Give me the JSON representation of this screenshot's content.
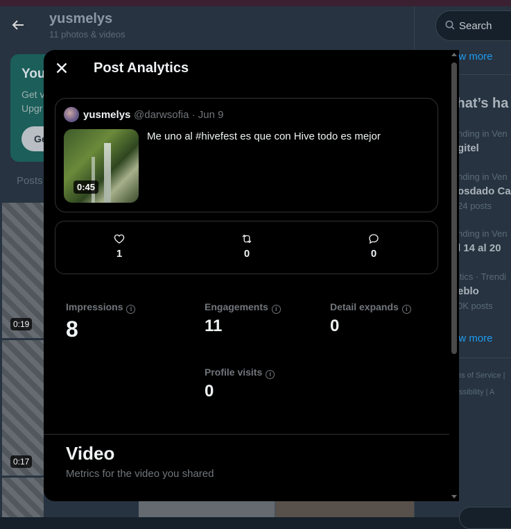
{
  "profile": {
    "name": "yusmelys",
    "subtitle": "11 photos & videos",
    "upgrade_title": "You",
    "upgrade_line1": "Get v",
    "upgrade_line2": "Upgr",
    "upgrade_button": "Ge",
    "posts_tab": "Posts",
    "media": [
      {
        "duration": "0:19"
      },
      {
        "duration": "0:17"
      }
    ]
  },
  "sidebar": {
    "search_placeholder": "Search",
    "show_more_top": "ow more",
    "whats_happening": "/hat’s ha",
    "trends": [
      {
        "meta": "nding in Ven",
        "name": "gitel",
        "count": ""
      },
      {
        "meta": "nding in Ven",
        "name": "osdado Ca",
        "count": "24 posts"
      },
      {
        "meta": "nding in Ven",
        "name": "l 14 al 20",
        "count": ""
      },
      {
        "meta": "itics · Trendi",
        "name": "eblo",
        "count": "0K posts"
      }
    ],
    "show_more_bottom": "ow more",
    "footer_1": "ms of Service  |",
    "footer_2": "essibility   |   A"
  },
  "modal": {
    "title": "Post Analytics",
    "post": {
      "author_name": "yusmelys",
      "author_meta": "@darwsofia · Jun 9",
      "text": "Me uno al #hivefest es que con Hive todo es mejor",
      "video_duration": "0:45"
    },
    "engagement": {
      "likes": "1",
      "reposts": "0",
      "replies": "0"
    },
    "metrics": {
      "impressions_label": "Impressions",
      "impressions_value": "8",
      "engagements_label": "Engagements",
      "engagements_value": "11",
      "detail_expands_label": "Detail expands",
      "detail_expands_value": "0",
      "profile_visits_label": "Profile visits",
      "profile_visits_value": "0"
    },
    "video_section": {
      "title": "Video",
      "subtitle": "Metrics for the video you shared"
    }
  },
  "colors": {
    "accent": "#1d9bf0",
    "modal_bg": "#000000",
    "page_bg": "#15202b"
  }
}
